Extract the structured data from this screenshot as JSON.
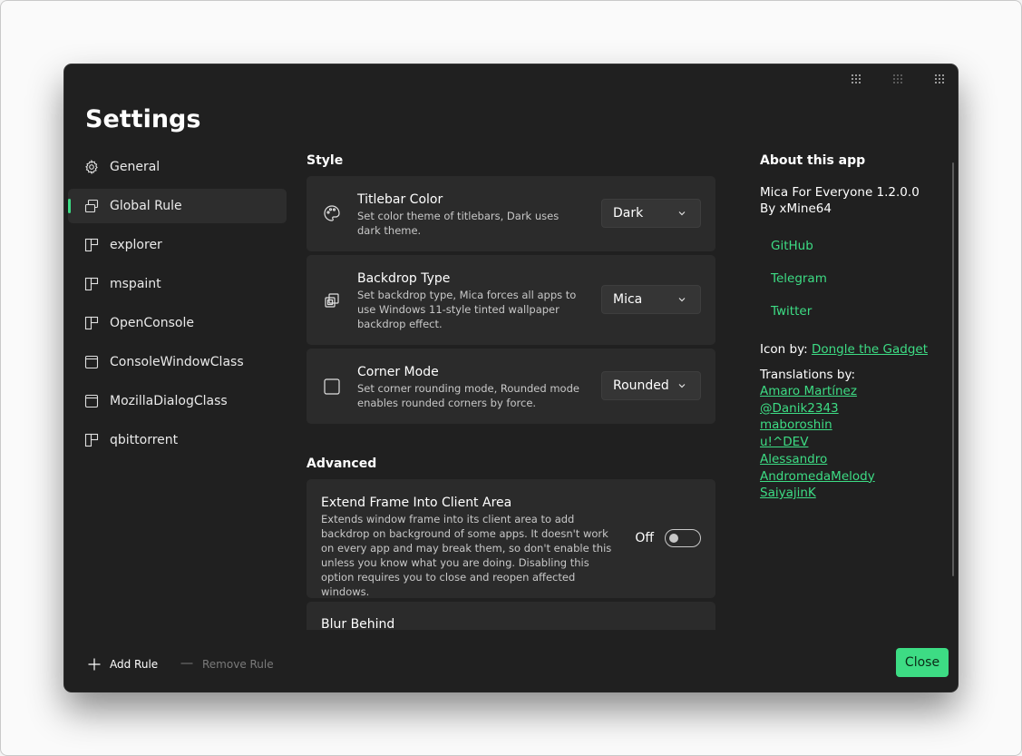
{
  "window": {
    "title": "Settings"
  },
  "nav": [
    {
      "label": "General",
      "icon": "gear-icon"
    },
    {
      "label": "Global Rule",
      "icon": "windows-stack-icon",
      "active": true
    },
    {
      "label": "explorer",
      "icon": "app-rule-icon"
    },
    {
      "label": "mspaint",
      "icon": "app-rule-icon"
    },
    {
      "label": "OpenConsole",
      "icon": "app-rule-icon"
    },
    {
      "label": "ConsoleWindowClass",
      "icon": "window-class-icon"
    },
    {
      "label": "MozillaDialogClass",
      "icon": "window-class-icon"
    },
    {
      "label": "qbittorrent",
      "icon": "app-rule-icon"
    }
  ],
  "style": {
    "heading": "Style",
    "titlebar": {
      "title": "Titlebar Color",
      "desc": "Set color theme of titlebars, Dark uses dark theme.",
      "value": "Dark"
    },
    "backdrop": {
      "title": "Backdrop Type",
      "desc": "Set backdrop type, Mica forces all apps to use Windows 11-style tinted wallpaper backdrop effect.",
      "value": "Mica"
    },
    "corner": {
      "title": "Corner Mode",
      "desc": "Set corner rounding mode, Rounded mode enables rounded corners by force.",
      "value": "Rounded"
    }
  },
  "advanced": {
    "heading": "Advanced",
    "extend": {
      "title": "Extend Frame Into Client Area",
      "desc": "Extends window frame into its client area to add backdrop on background of some apps. It doesn't work on every app and may break them, so don't enable this unless you know what you are doing. Disabling this option requires you to close and reopen affected windows.",
      "state": "Off"
    },
    "blur": {
      "title": "Blur Behind"
    }
  },
  "about": {
    "heading": "About this app",
    "app_name": "Mica For Everyone 1.2.0.0",
    "author": "By xMine64",
    "links": [
      "GitHub",
      "Telegram",
      "Twitter"
    ],
    "icon_by_label": "Icon by:",
    "icon_by_link": "Dongle the Gadget",
    "translations_label": "Translations by:",
    "translators": [
      "Amaro Martínez",
      "@Danik2343",
      "maboroshin",
      "u!^DEV",
      "Alessandro",
      "AndromedaMelody",
      "SaiyajinK"
    ]
  },
  "footer": {
    "add_rule": "Add Rule",
    "remove_rule": "Remove Rule",
    "close": "Close"
  },
  "colors": {
    "accent": "#3ddc84",
    "window_bg": "#202020",
    "card_bg": "#2b2b2b"
  }
}
